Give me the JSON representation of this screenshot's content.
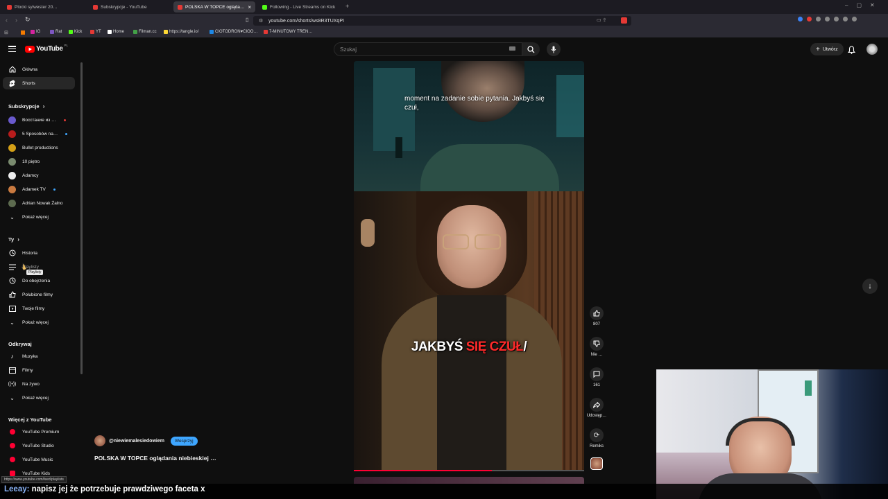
{
  "browser": {
    "tabs": [
      {
        "title": "Plocki sylwester 20…",
        "color": "#e53935"
      },
      {
        "title": "Subskrypcje - YouTube",
        "color": "#e53935"
      },
      {
        "title": "POLSKA W TOPCE ogląda…",
        "color": "#e53935",
        "active": true
      },
      {
        "title": "Following - Live Streams on Kick",
        "color": "#53fc18"
      }
    ],
    "url": "youtube.com/shorts/ws8R3TUXqPI",
    "bookmarks": [
      {
        "label": "IG",
        "color": "#d6249f"
      },
      {
        "label": "Rat",
        "color": "#7e57c2"
      },
      {
        "label": "Kick",
        "color": "#53fc18"
      },
      {
        "label": "YT",
        "color": "#e53935"
      },
      {
        "label": "Home",
        "color": "#ffffff"
      },
      {
        "label": "Filman.cc",
        "color": "#43a047"
      },
      {
        "label": "https://tangle.io/",
        "color": "#fdd835"
      },
      {
        "label": "CIOTODRON♥CIOO…",
        "color": "#1e88e5"
      },
      {
        "label": "7-MINUTOWY TREN…",
        "color": "#e53935"
      }
    ]
  },
  "header": {
    "logo": "YouTube",
    "logo_region": "PL",
    "search_placeholder": "Szukaj",
    "create_label": "Utwórz"
  },
  "sidebar": {
    "home": "Główna",
    "shorts": "Shorts",
    "subs_header": "Subskrypcje",
    "subscriptions": [
      {
        "name": "Восстание из …",
        "color": "#6a5acd",
        "live": true
      },
      {
        "name": "5 Sposobów na…",
        "color": "#b71c1c",
        "dot": true
      },
      {
        "name": "Bullet productions",
        "color": "#d4a017"
      },
      {
        "name": "10 piętro",
        "color": "#7a8b6f"
      },
      {
        "name": "Adamcy",
        "color": "#eeeeee"
      },
      {
        "name": "Adamek TV",
        "color": "#c97a40",
        "dot": true
      },
      {
        "name": "Adrian Nowak Żalno",
        "color": "#5d6b4f"
      }
    ],
    "show_more_1": "Pokaż więcej",
    "you_header": "Ty",
    "you_items": [
      {
        "label": "Historia",
        "icon": "history-icon"
      },
      {
        "label": "Playlisty",
        "icon": "playlist-icon"
      },
      {
        "label": "Do obejrzenia",
        "icon": "clock-icon"
      },
      {
        "label": "Polubione filmy",
        "icon": "thumbs-up-icon"
      },
      {
        "label": "Twoje filmy",
        "icon": "video-icon"
      }
    ],
    "tooltip": "Playlisty",
    "show_more_2": "Pokaż więcej",
    "explore_header": "Odkrywaj",
    "explore_items": [
      {
        "label": "Muzyka",
        "icon": "music-icon"
      },
      {
        "label": "Filmy",
        "icon": "film-icon"
      },
      {
        "label": "Na żywo",
        "icon": "live-icon"
      }
    ],
    "show_more_3": "Pokaż więcej",
    "more_header": "Więcej z YouTube",
    "more_items": [
      {
        "label": "YouTube Premium"
      },
      {
        "label": "YouTube Studio"
      },
      {
        "label": "YouTube Music"
      },
      {
        "label": "YouTube Kids"
      }
    ]
  },
  "short": {
    "caption_top": "moment na zadanie sobie pytania. Jakbyś się czuł,",
    "caption_big_white_1": "JAKBYŚ",
    "caption_big_red": "SIĘ CZUŁ",
    "caption_big_white_2": "/",
    "channel": "@niewiemalesiedowiem",
    "support_label": "Wesprzyj",
    "title": "POLSKA W TOPCE oglądania niebieskiej …",
    "likes": "807",
    "dislike_label": "Nie …",
    "comments": "161",
    "share_label": "Udostęp…",
    "remix_label": "Remiks"
  },
  "status_url": "https://www.youtube.com/feed/playlists",
  "chat_overlay": {
    "user": "Leeay:",
    "message": "napisz jej że potrzebuje prawdziwego faceta x"
  }
}
